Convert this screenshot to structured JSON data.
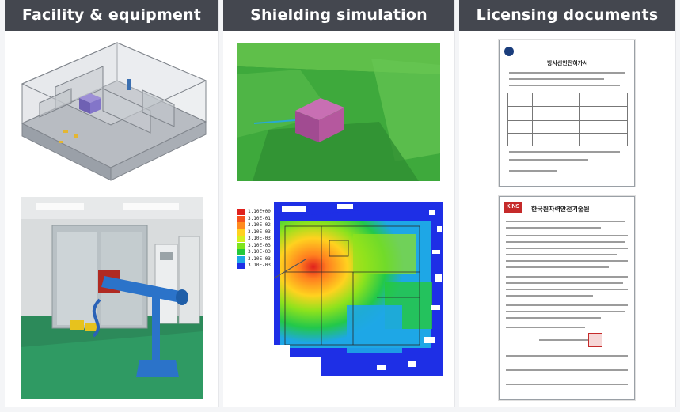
{
  "columns": [
    {
      "title": "Facility & equipment"
    },
    {
      "title": "Shielding simulation"
    },
    {
      "title": "Licensing documents"
    }
  ],
  "colorbar": {
    "labels": [
      "1.10E+00",
      "3.10E-01",
      "3.10E-02",
      "3.10E-03",
      "3.10E-03",
      "3.10E-03",
      "3.10E-03",
      "3.10E-03",
      "3.10E-03"
    ],
    "colors": [
      "#e0211d",
      "#f5511e",
      "#ff8b1f",
      "#ffd21f",
      "#d6f01e",
      "#7fe51d",
      "#25c93b",
      "#1ea7e6",
      "#1e2fe6"
    ]
  },
  "documents": [
    {
      "heading": "방사선안전허가서",
      "type": "license-certificate"
    },
    {
      "heading": "한국원자력안전기술원",
      "logo": "KINS",
      "type": "inspection-report"
    }
  ]
}
